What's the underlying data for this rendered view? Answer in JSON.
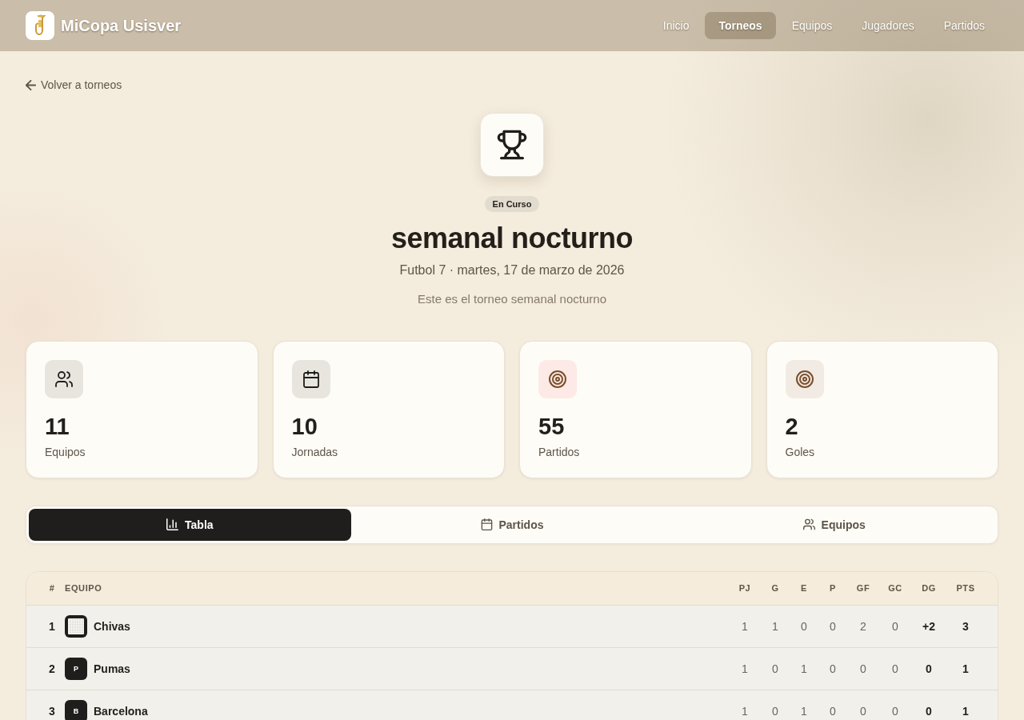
{
  "header": {
    "brand": "MiCopa Usisver",
    "nav": [
      {
        "label": "Inicio",
        "selected": false
      },
      {
        "label": "Torneos",
        "selected": true
      },
      {
        "label": "Equipos",
        "selected": false
      },
      {
        "label": "Jugadores",
        "selected": false
      },
      {
        "label": "Partidos",
        "selected": false
      }
    ]
  },
  "back_link": "Volver a torneos",
  "tournament": {
    "status": "En Curso",
    "title": "semanal nocturno",
    "subtitle": "Futbol 7 · martes, 17 de marzo de 2026",
    "description": "Este es el torneo semanal nocturno"
  },
  "stats": [
    {
      "value": "11",
      "label": "Equipos",
      "kind": "users",
      "color": "#e8e5df"
    },
    {
      "value": "10",
      "label": "Jornadas",
      "kind": "calendar",
      "color": "#e8e5df"
    },
    {
      "value": "55",
      "label": "Partidos",
      "kind": "target",
      "color": "#fdeae6"
    },
    {
      "value": "2",
      "label": "Goles",
      "kind": "target",
      "color": "#f1ebe3"
    }
  ],
  "tabs": [
    {
      "label": "Tabla",
      "kind": "chart",
      "selected": true
    },
    {
      "label": "Partidos",
      "kind": "calendar",
      "selected": false
    },
    {
      "label": "Equipos",
      "kind": "users",
      "selected": false
    }
  ],
  "standings": {
    "columns": [
      "#",
      "EQUIPO",
      "PJ",
      "G",
      "E",
      "P",
      "GF",
      "GC",
      "DG",
      "PTS"
    ],
    "rows": [
      {
        "crest": {
          "kind": "image"
        },
        "cells": [
          "1",
          "Chivas",
          "1",
          "1",
          "0",
          "0",
          "2",
          "0",
          "+2",
          "3"
        ]
      },
      {
        "crest": {
          "kind": "letter",
          "text": "P"
        },
        "cells": [
          "2",
          "Pumas",
          "1",
          "0",
          "1",
          "0",
          "0",
          "0",
          "0",
          "1"
        ]
      },
      {
        "crest": {
          "kind": "letter",
          "text": "B"
        },
        "cells": [
          "3",
          "Barcelona",
          "1",
          "0",
          "1",
          "0",
          "0",
          "0",
          "0",
          "1"
        ]
      }
    ]
  }
}
